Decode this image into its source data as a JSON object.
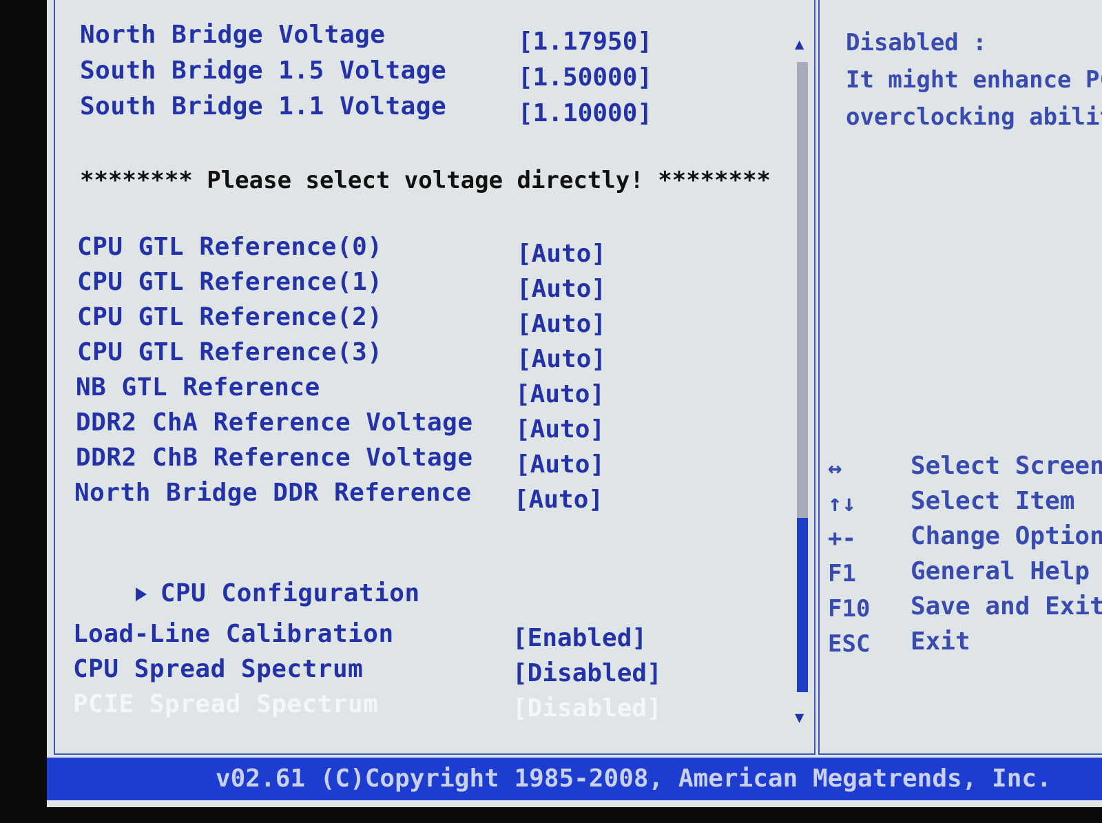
{
  "voltages": [
    {
      "label": "North Bridge Voltage",
      "value": "[1.17950]"
    },
    {
      "label": "South Bridge 1.5 Voltage",
      "value": "[1.50000]"
    },
    {
      "label": "South Bridge 1.1 Voltage",
      "value": "[1.10000]"
    }
  ],
  "notice": "******** Please select voltage directly! ********",
  "references": [
    {
      "label": "CPU GTL Reference(0)",
      "value": "[Auto]"
    },
    {
      "label": "CPU GTL Reference(1)",
      "value": "[Auto]"
    },
    {
      "label": "CPU GTL Reference(2)",
      "value": "[Auto]"
    },
    {
      "label": "CPU GTL Reference(3)",
      "value": "[Auto]"
    },
    {
      "label": "NB GTL Reference",
      "value": "[Auto]"
    },
    {
      "label": "DDR2 ChA Reference Voltage",
      "value": "[Auto]"
    },
    {
      "label": "DDR2 ChB Reference Voltage",
      "value": "[Auto]"
    },
    {
      "label": "North Bridge DDR Reference",
      "value": "[Auto]"
    }
  ],
  "submenu": {
    "label": "CPU Configuration"
  },
  "options": [
    {
      "label": "Load-Line Calibration",
      "value": "[Enabled]"
    },
    {
      "label": "CPU Spread Spectrum",
      "value": "[Disabled]"
    },
    {
      "label": "PCIE Spread Spectrum",
      "value": "[Disabled]"
    }
  ],
  "help": {
    "line1": "Disabled :",
    "line2": "It might enhance PC",
    "line3": "overclocking abilit"
  },
  "keys": [
    {
      "key": "↔",
      "desc": "Select Screen"
    },
    {
      "key": "↑↓",
      "desc": "Select Item"
    },
    {
      "key": "+-",
      "desc": "Change Option"
    },
    {
      "key": "F1",
      "desc": "General Help"
    },
    {
      "key": "F10",
      "desc": "Save and Exit"
    },
    {
      "key": "ESC",
      "desc": "Exit"
    }
  ],
  "footer": "v02.61 (C)Copyright 1985-2008, American Megatrends, Inc.",
  "colors": {
    "text": "#2432a8",
    "footer_bg": "#1c3dcf",
    "screen_bg": "#dfe4e6",
    "highlight": "#f4f6f8"
  }
}
